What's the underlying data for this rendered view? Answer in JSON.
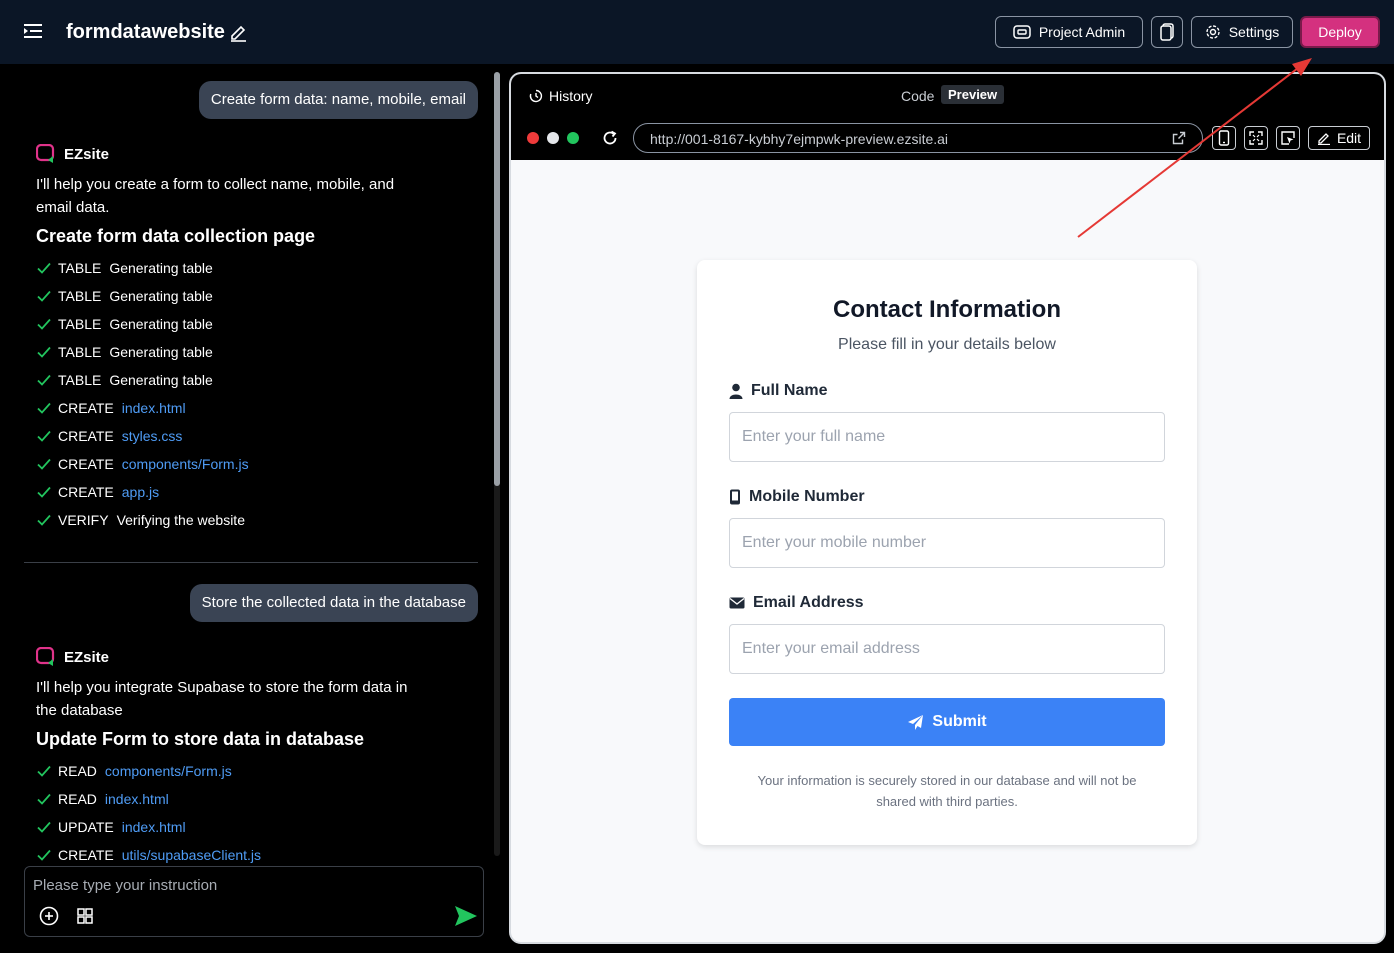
{
  "header": {
    "title": "formdatawebsite",
    "project_admin": "Project Admin",
    "settings": "Settings",
    "deploy": "Deploy"
  },
  "chat": {
    "messages": [
      {
        "user": "Create form data: name, mobile, email",
        "bot_name": "EZsite",
        "bot_text": "I'll help you create a form to collect name, mobile, and email data.",
        "heading": "Create form data collection page",
        "steps": [
          {
            "action": "TABLE",
            "target": "Generating table",
            "link": false
          },
          {
            "action": "TABLE",
            "target": "Generating table",
            "link": false
          },
          {
            "action": "TABLE",
            "target": "Generating table",
            "link": false
          },
          {
            "action": "TABLE",
            "target": "Generating table",
            "link": false
          },
          {
            "action": "TABLE",
            "target": "Generating table",
            "link": false
          },
          {
            "action": "CREATE",
            "target": "index.html",
            "link": true
          },
          {
            "action": "CREATE",
            "target": "styles.css",
            "link": true
          },
          {
            "action": "CREATE",
            "target": "components/Form.js",
            "link": true
          },
          {
            "action": "CREATE",
            "target": "app.js",
            "link": true
          },
          {
            "action": "VERIFY",
            "target": "Verifying the website",
            "link": false
          }
        ]
      },
      {
        "user": "Store the collected data in the database",
        "bot_name": "EZsite",
        "bot_text": "I'll help you integrate Supabase to store the form data in the database",
        "heading": "Update Form to store data in database",
        "steps": [
          {
            "action": "READ",
            "target": "components/Form.js",
            "link": true
          },
          {
            "action": "READ",
            "target": "index.html",
            "link": true
          },
          {
            "action": "UPDATE",
            "target": "index.html",
            "link": true
          },
          {
            "action": "CREATE",
            "target": "utils/supabaseClient.js",
            "link": true
          }
        ]
      }
    ],
    "input_placeholder": "Please type your instruction"
  },
  "preview": {
    "history": "History",
    "code_tab": "Code",
    "preview_tab": "Preview",
    "url": "http://001-8167-kybhy7ejmpwk-preview.ezsite.ai",
    "edit": "Edit",
    "form": {
      "title": "Contact Information",
      "subtitle": "Please fill in your details below",
      "name_label": "Full Name",
      "name_placeholder": "Enter your full name",
      "mobile_label": "Mobile Number",
      "mobile_placeholder": "Enter your mobile number",
      "email_label": "Email Address",
      "email_placeholder": "Enter your email address",
      "submit": "Submit",
      "disclaimer": "Your information is securely stored in our database and will not be shared with third parties."
    }
  },
  "colors": {
    "deploy": "#d4317f",
    "accent_blue": "#3b82f6",
    "link": "#4f9cf5",
    "check": "#22c55e",
    "annotation": "#e53935"
  },
  "icons": [
    "menu-icon",
    "pencil-icon",
    "admin-icon",
    "copy-icon",
    "gear-icon",
    "ezsite-logo-icon",
    "check-icon",
    "plus-circle-icon",
    "grid-icon",
    "send-icon",
    "history-icon",
    "reload-icon",
    "external-link-icon",
    "mobile-view-icon",
    "expand-icon",
    "inspect-icon",
    "user-icon",
    "phone-icon",
    "envelope-icon",
    "paper-plane-icon"
  ]
}
